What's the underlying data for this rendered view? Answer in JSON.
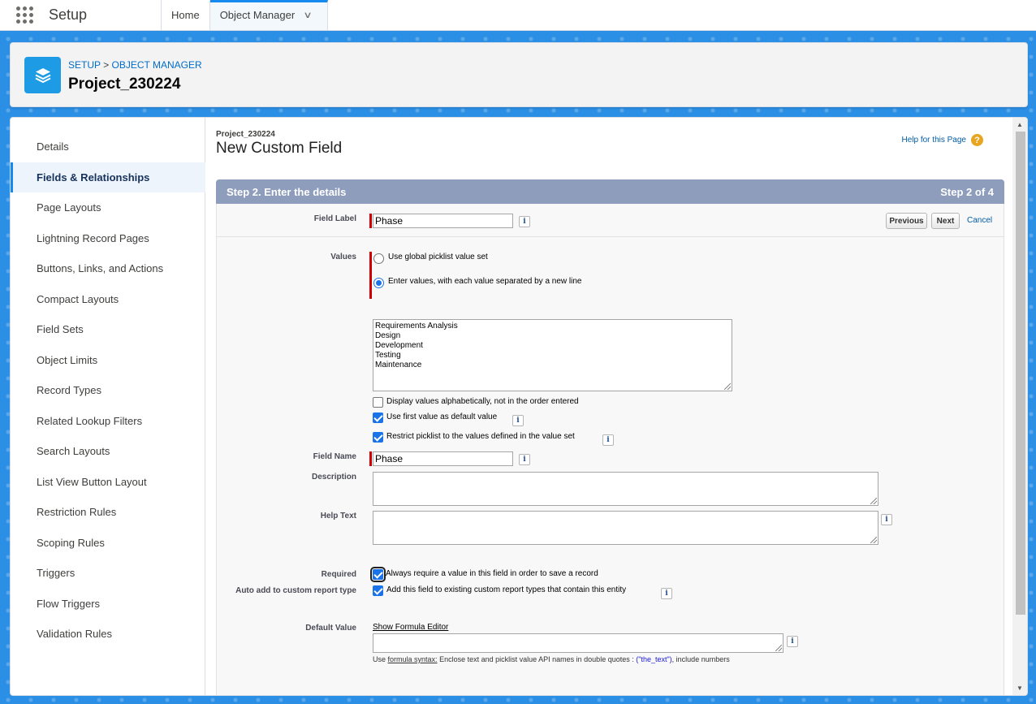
{
  "topnav": {
    "app_name": "Setup",
    "tabs": [
      {
        "label": "Home"
      },
      {
        "label": "Object Manager"
      }
    ]
  },
  "header": {
    "breadcrumb_setup": "SETUP",
    "breadcrumb_sep": ">",
    "breadcrumb_object_manager": "OBJECT MANAGER",
    "title": "Project_230224"
  },
  "sidebar": {
    "items": [
      {
        "label": "Details"
      },
      {
        "label": "Fields & Relationships",
        "active": true
      },
      {
        "label": "Page Layouts"
      },
      {
        "label": "Lightning Record Pages"
      },
      {
        "label": "Buttons, Links, and Actions"
      },
      {
        "label": "Compact Layouts"
      },
      {
        "label": "Field Sets"
      },
      {
        "label": "Object Limits"
      },
      {
        "label": "Record Types"
      },
      {
        "label": "Related Lookup Filters"
      },
      {
        "label": "Search Layouts"
      },
      {
        "label": "List View Button Layout"
      },
      {
        "label": "Restriction Rules"
      },
      {
        "label": "Scoping Rules"
      },
      {
        "label": "Triggers"
      },
      {
        "label": "Flow Triggers"
      },
      {
        "label": "Validation Rules"
      }
    ]
  },
  "page": {
    "object_name": "Project_230224",
    "title": "New Custom Field",
    "help_link": "Help for this Page",
    "help_icon": "?",
    "step_title": "Step 2. Enter the details",
    "step_count": "Step 2 of 4",
    "buttons": {
      "previous": "Previous",
      "next": "Next",
      "cancel": "Cancel"
    }
  },
  "form": {
    "info_glyph": "i",
    "field_label": {
      "label": "Field Label",
      "value": "Phase"
    },
    "values": {
      "label": "Values",
      "option_global": "Use global picklist value set",
      "option_enter": "Enter values, with each value separated by a new line",
      "selected": "enter",
      "entries": [
        "Requirements Analysis",
        "Design",
        "Development",
        "Testing",
        "Maintenance"
      ],
      "display_alphabetically": {
        "label": "Display values alphabetically, not in the order entered",
        "checked": false
      },
      "use_first_default": {
        "label": "Use first value as default value",
        "checked": true
      },
      "restrict_picklist": {
        "label": "Restrict picklist to the values defined in the value set",
        "checked": true
      }
    },
    "field_name": {
      "label": "Field Name",
      "value": "Phase"
    },
    "description": {
      "label": "Description",
      "value": ""
    },
    "help_text": {
      "label": "Help Text",
      "value": ""
    },
    "required": {
      "label": "Required",
      "text": "Always require a value in this field in order to save a record",
      "checked": true
    },
    "auto_add": {
      "label": "Auto add to custom report type",
      "text": "Add this field to existing custom report types that contain this entity",
      "checked": true
    },
    "default_value": {
      "label": "Default Value",
      "formula_link": "Show Formula Editor",
      "value": "",
      "syntax_prefix": "Use",
      "syntax_link": "formula syntax:",
      "syntax_text": "Enclose text and picklist value API names in double quotes :",
      "syntax_example": "(\"the_text\")",
      "syntax_suffix": ", include numbers"
    }
  }
}
